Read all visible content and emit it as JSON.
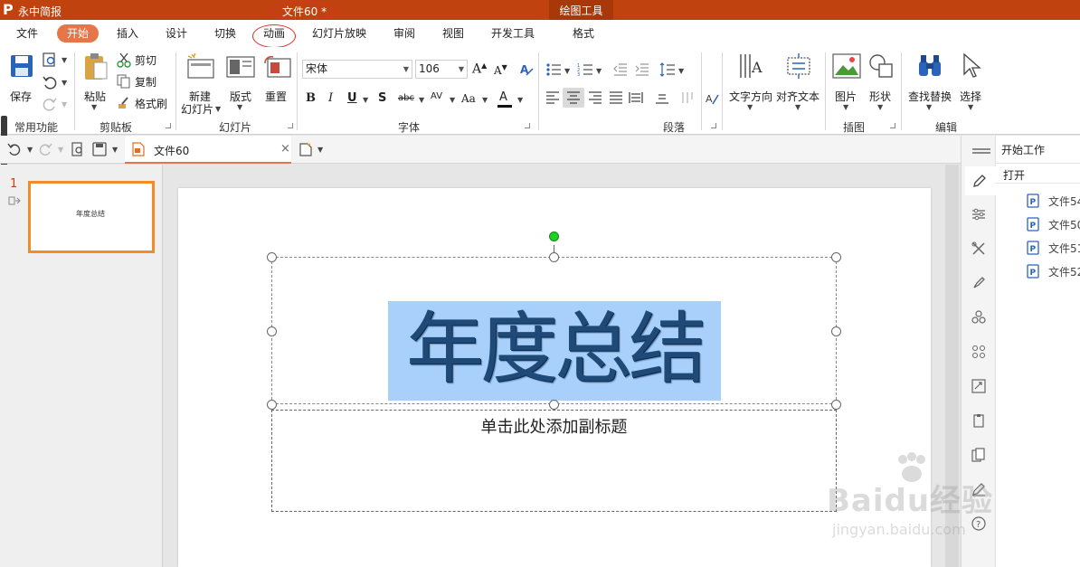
{
  "title_bar": {
    "app_name": "永中简报",
    "document_title": "文件60 *",
    "context_tab": "绘图工具"
  },
  "menu": {
    "tabs": [
      "文件",
      "开始",
      "插入",
      "设计",
      "切换",
      "动画",
      "幻灯片放映",
      "审阅",
      "视图",
      "开发工具",
      "格式"
    ],
    "active": "开始"
  },
  "ribbon": {
    "save": "保存",
    "paste": "粘贴",
    "cut": "剪切",
    "copy": "复制",
    "format_painter": "格式刷",
    "new_slide_line1": "新建",
    "new_slide_line2": "幻灯片",
    "layout": "版式",
    "reset": "重置",
    "font_name": "宋体",
    "font_size": "106",
    "text_direction": "文字方向",
    "align_text": "对齐文本",
    "picture": "图片",
    "shape": "形状",
    "find_replace": "查找替换",
    "select": "选择",
    "groups": {
      "common": "常用功能",
      "clipboard": "剪贴板",
      "slides": "幻灯片",
      "font": "字体",
      "paragraph": "段落",
      "illustration": "插图",
      "edit": "编辑"
    }
  },
  "doc_tab": {
    "label": "文件60"
  },
  "slide_pane": {
    "number": "1",
    "thumb_title": "年度总结"
  },
  "slide": {
    "title": "年度总结",
    "subtitle_placeholder": "单击此处添加副标题"
  },
  "right_panel": {
    "heading": "开始工作",
    "open": "打开",
    "files": [
      "文件54",
      "文件50",
      "文件51",
      "文件52"
    ]
  },
  "watermark": {
    "brand": "Baidu经验",
    "url": "jingyan.baidu.com"
  },
  "colors": {
    "title_bar": "#c0420e",
    "active_tab": "#e8744a",
    "thumb_border": "#f28c28",
    "selection": "#a8d0fa",
    "title_text": "#1f4a78"
  }
}
